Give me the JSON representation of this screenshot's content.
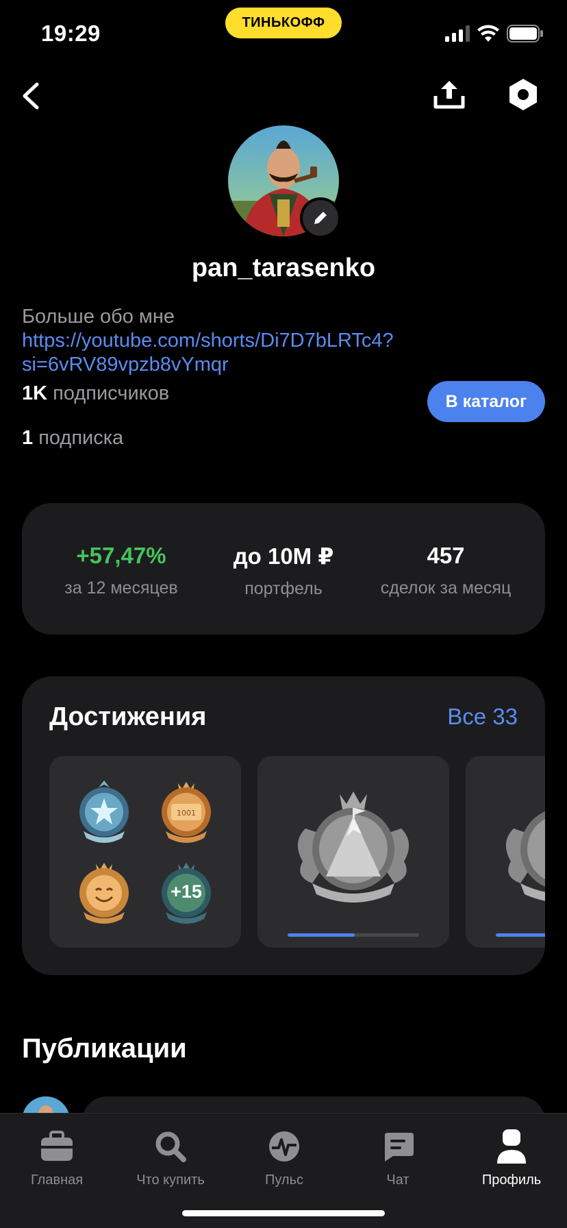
{
  "status_bar": {
    "time": "19:29",
    "brand": "ТИНЬКОФФ"
  },
  "profile": {
    "username": "pan_tarasenko",
    "bio_prefix": "Больше обо мне",
    "bio_link": "https://youtube.com/shorts/Di7D7bLRTc4?si=6vRV89vpzb8vYmqr",
    "followers_count": "1K",
    "followers_label": "подписчиков",
    "following_count": "1",
    "following_label": "подписка",
    "catalog_button": "В каталог"
  },
  "metrics": [
    {
      "value": "+57,47%",
      "caption": "за 12 месяцев"
    },
    {
      "value": "до 10M ₽",
      "caption": "портфель"
    },
    {
      "value": "457",
      "caption": "сделок за месяц"
    }
  ],
  "achievements": {
    "title": "Достижения",
    "all_link": "Все 33",
    "more_count": "+15",
    "badge_text_1001": "1001",
    "progress": [
      0.51,
      0.6
    ]
  },
  "publications": {
    "title": "Публикации"
  },
  "tabs": [
    {
      "label": "Главная",
      "icon": "briefcase-icon"
    },
    {
      "label": "Что купить",
      "icon": "search-icon"
    },
    {
      "label": "Пульс",
      "icon": "pulse-icon"
    },
    {
      "label": "Чат",
      "icon": "chat-icon"
    },
    {
      "label": "Профиль",
      "icon": "profile-icon",
      "active": true
    }
  ],
  "colors": {
    "accent": "#4c82ed",
    "link": "#5b8cf2",
    "positive": "#45c35d",
    "brand": "#ffdd2d"
  }
}
